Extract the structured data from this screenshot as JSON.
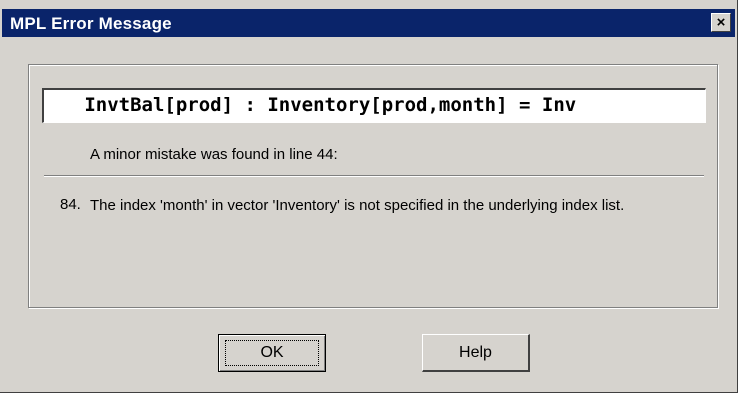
{
  "window": {
    "title": "MPL Error Message"
  },
  "icons": {
    "close": "close-icon"
  },
  "error": {
    "code_line": "   InvtBal[prod] : Inventory[prod,month] = Inv",
    "summary": "A minor mistake was found in line 44:",
    "number": "84.",
    "message": "The index 'month' in vector 'Inventory' is not specified in the underlying index list."
  },
  "buttons": {
    "ok": "OK",
    "help": "Help",
    "close": "×"
  }
}
